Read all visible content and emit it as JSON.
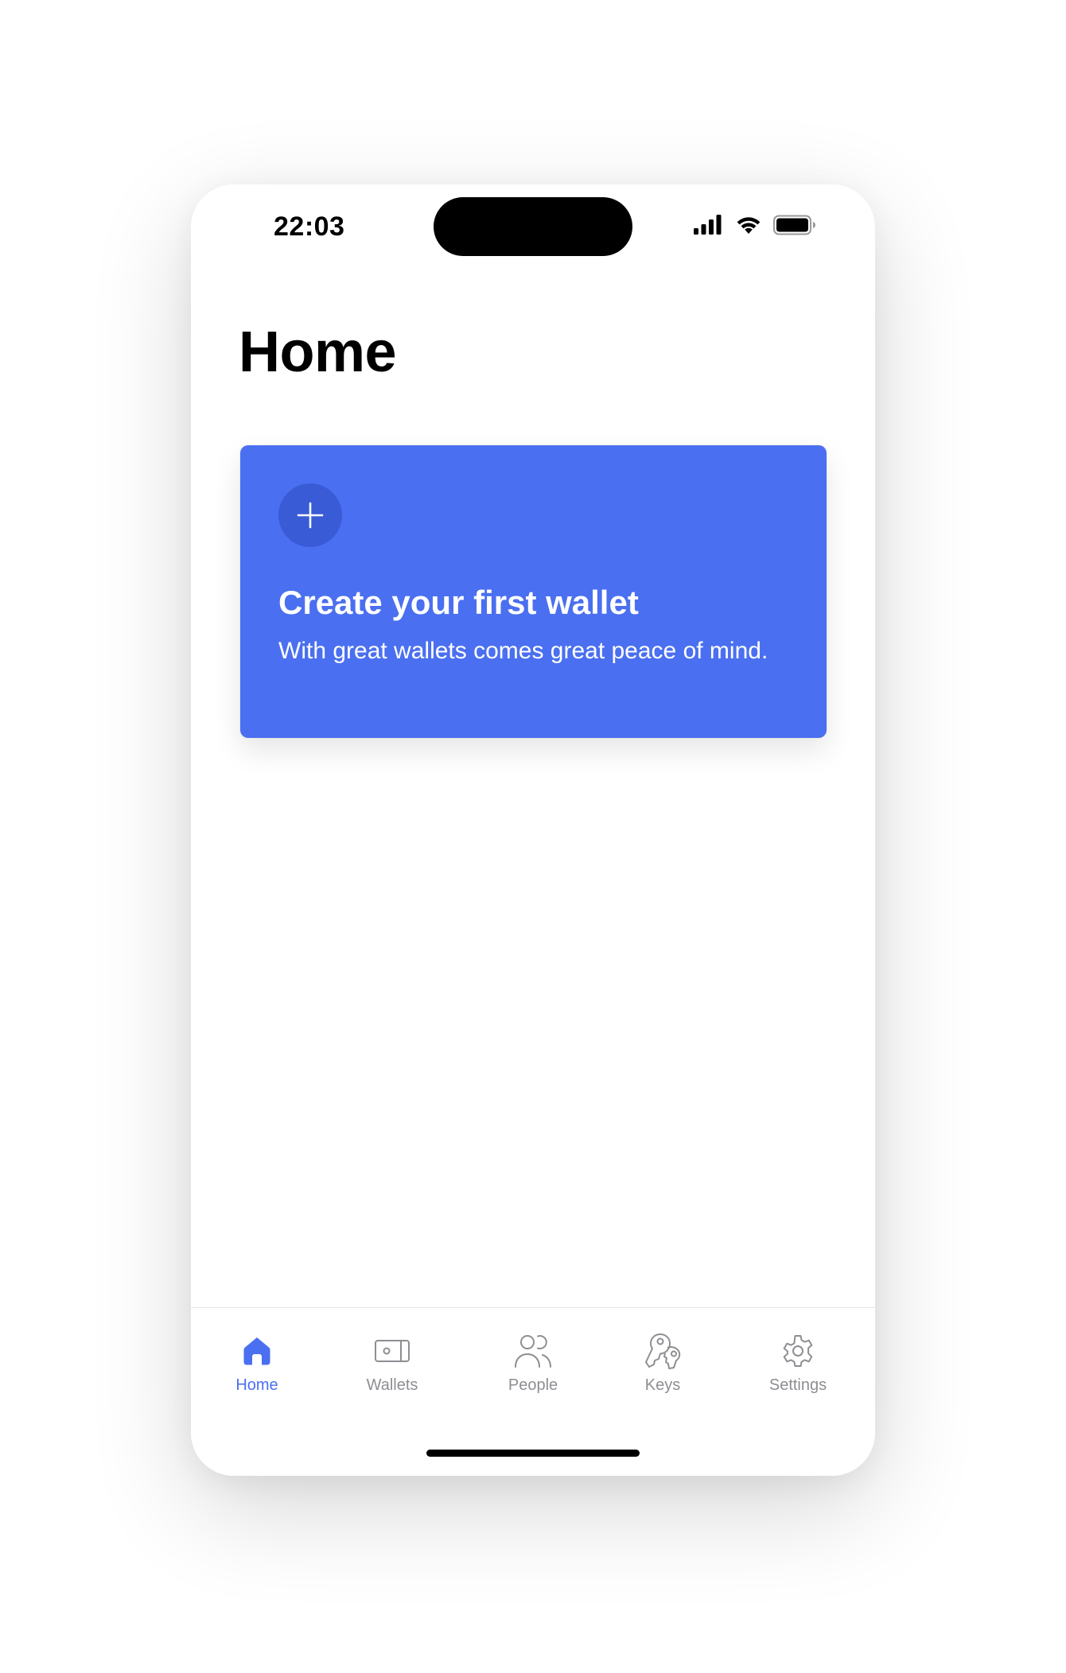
{
  "status_bar": {
    "time": "22:03",
    "icons": [
      "cellular-signal-icon",
      "wifi-icon",
      "battery-icon"
    ]
  },
  "page": {
    "title": "Home"
  },
  "create_card": {
    "icon": "plus-icon",
    "title": "Create your first wallet",
    "subtitle": "With great wallets comes great peace of mind."
  },
  "tab_bar": {
    "tabs": [
      {
        "label": "Home",
        "icon": "home-icon",
        "active": true
      },
      {
        "label": "Wallets",
        "icon": "wallet-icon",
        "active": false
      },
      {
        "label": "People",
        "icon": "people-icon",
        "active": false
      },
      {
        "label": "Keys",
        "icon": "keys-icon",
        "active": false
      },
      {
        "label": "Settings",
        "icon": "gear-icon",
        "active": false
      }
    ]
  },
  "colors": {
    "accent": "#4A6FF0",
    "accent_dark": "#3A5BD6",
    "inactive": "#8E8E93",
    "text": "#000000"
  }
}
